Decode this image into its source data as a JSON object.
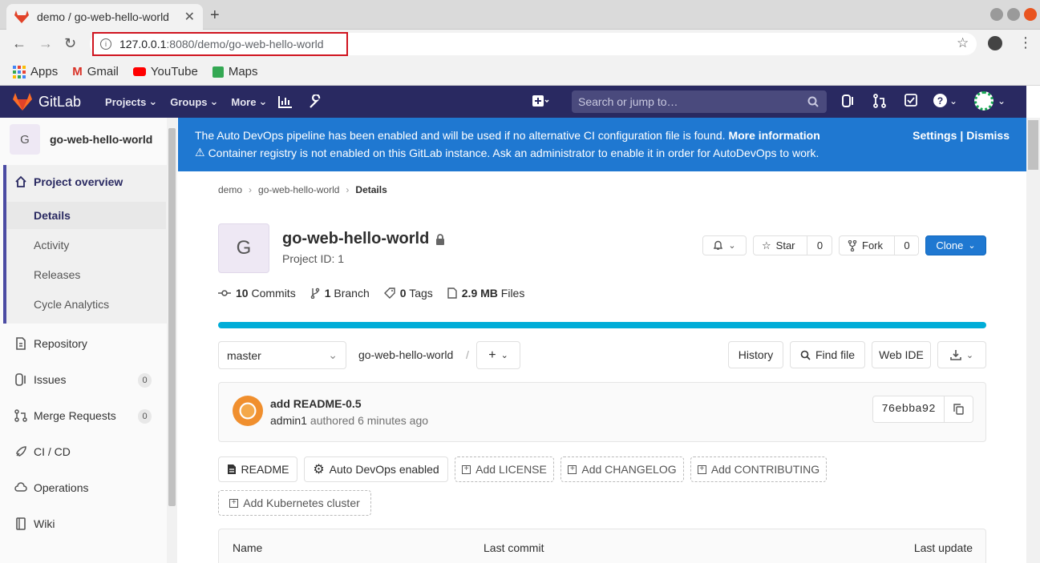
{
  "browser": {
    "tab_title": "demo / go-web-hello-world",
    "url_host": "127.0.0.1",
    "url_path": ":8080/demo/go-web-hello-world",
    "bookmarks": [
      "Apps",
      "Gmail",
      "YouTube",
      "Maps"
    ]
  },
  "nav": {
    "brand": "GitLab",
    "menus": [
      "Projects",
      "Groups",
      "More"
    ],
    "search_placeholder": "Search or jump to…"
  },
  "sidebar": {
    "project_initial": "G",
    "project_name": "go-web-hello-world",
    "overview": "Project overview",
    "subitems": [
      "Details",
      "Activity",
      "Releases",
      "Cycle Analytics"
    ],
    "items": [
      {
        "label": "Repository"
      },
      {
        "label": "Issues",
        "badge": "0"
      },
      {
        "label": "Merge Requests",
        "badge": "0"
      },
      {
        "label": "CI / CD"
      },
      {
        "label": "Operations"
      },
      {
        "label": "Wiki"
      }
    ]
  },
  "banner": {
    "line1": "The Auto DevOps pipeline has been enabled and will be used if no alternative CI configuration file is found.",
    "more_info": "More information",
    "line2": "Container registry is not enabled on this GitLab instance. Ask an administrator to enable it in order for AutoDevOps to work.",
    "settings": "Settings",
    "sep": "|",
    "dismiss": "Dismiss"
  },
  "breadcrumb": [
    "demo",
    "go-web-hello-world",
    "Details"
  ],
  "project": {
    "initial": "G",
    "name": "go-web-hello-world",
    "id_text": "Project ID: 1",
    "star": "Star",
    "star_count": "0",
    "fork": "Fork",
    "fork_count": "0",
    "clone": "Clone"
  },
  "stats": [
    {
      "count": "10",
      "label": "Commits"
    },
    {
      "count": "1",
      "label": "Branch"
    },
    {
      "count": "0",
      "label": "Tags"
    },
    {
      "count": "2.9 MB",
      "label": "Files"
    }
  ],
  "repo": {
    "branch": "master",
    "path": "go-web-hello-world",
    "history": "History",
    "find_file": "Find file",
    "web_ide": "Web IDE"
  },
  "commit": {
    "title": "add README-0.5",
    "author": "admin1",
    "meta": "authored 6 minutes ago",
    "sha": "76ebba92"
  },
  "actions": [
    "README",
    "Auto DevOps enabled",
    "Add LICENSE",
    "Add CHANGELOG",
    "Add CONTRIBUTING",
    "Add Kubernetes cluster"
  ],
  "table": {
    "headers": [
      "Name",
      "Last commit",
      "Last update"
    ]
  },
  "colors": {
    "nav_bg": "#292961",
    "banner_bg": "#1f78d1",
    "clone_bg": "#1f78d1",
    "progress": "#1aaa55"
  }
}
